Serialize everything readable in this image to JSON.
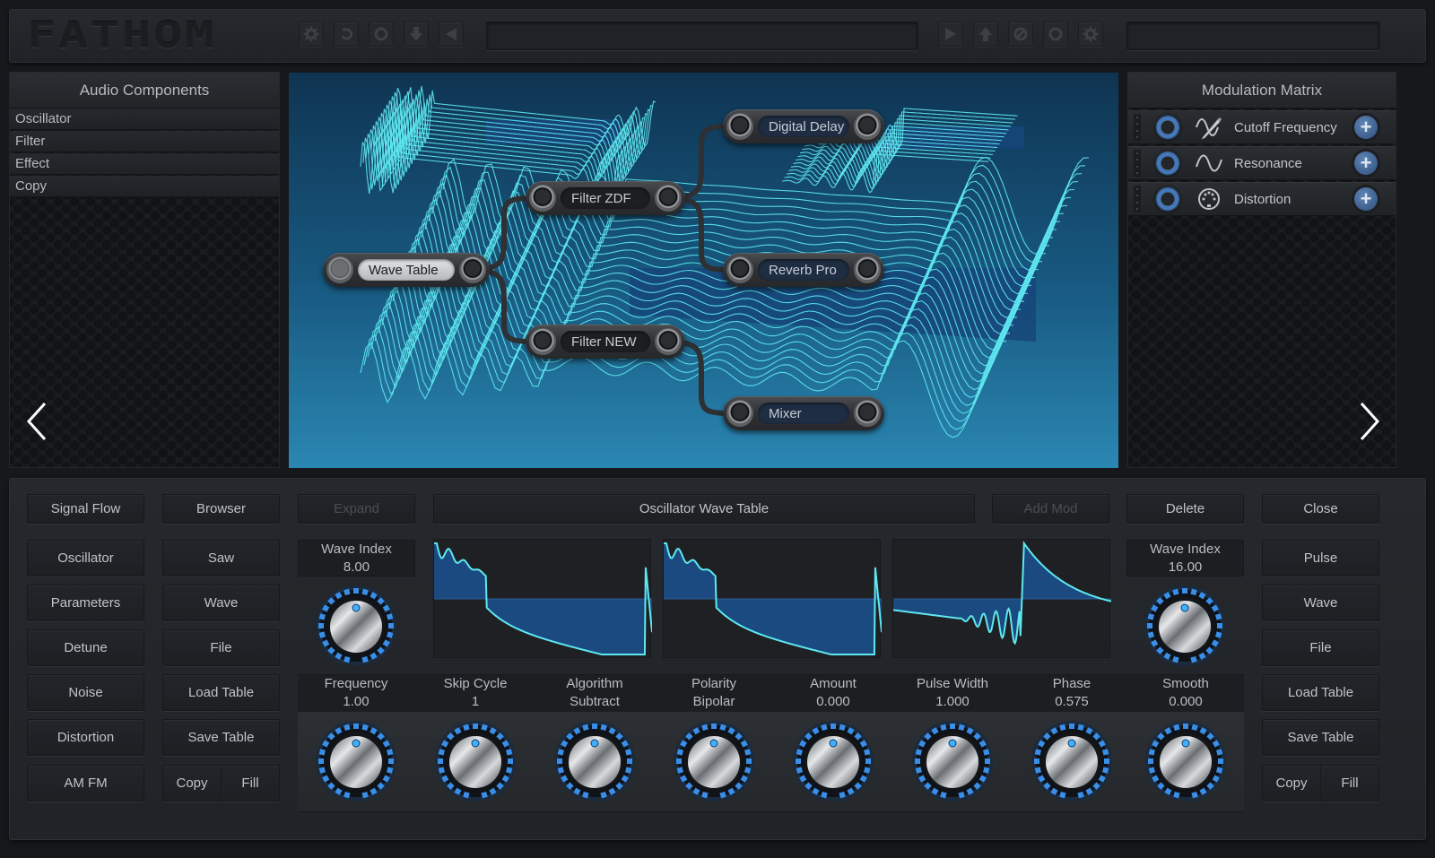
{
  "app": {
    "logo": "FATHOM",
    "accent_color": "#3a8ee8",
    "wave_color": "#5ee8f0",
    "wave_fill_color": "#1a4a80"
  },
  "toolbar": {
    "left_icons": [
      "gear-icon",
      "undo-icon",
      "circle-icon",
      "download-arrow-icon",
      "play-back-icon"
    ],
    "right_icons": [
      "play-icon",
      "upload-arrow-icon",
      "no-entry-icon",
      "circle-icon",
      "gear-icon"
    ],
    "center_field_value": "",
    "right_field_value": ""
  },
  "audio_components": {
    "title": "Audio Components",
    "items": [
      {
        "label": "Oscillator"
      },
      {
        "label": "Filter"
      },
      {
        "label": "Effect"
      },
      {
        "label": "Copy"
      }
    ]
  },
  "modulation_matrix": {
    "title": "Modulation Matrix",
    "rows": [
      {
        "label": "Cutoff Frequency",
        "icon": "pencil-wave-icon"
      },
      {
        "label": "Resonance",
        "icon": "sine-wave-icon"
      },
      {
        "label": "Distortion",
        "icon": "midi-port-icon"
      }
    ]
  },
  "signal_flow": {
    "nodes": [
      {
        "id": "wave-table",
        "label": "Wave Table"
      },
      {
        "id": "filter-zdf",
        "label": "Filter ZDF"
      },
      {
        "id": "filter-new",
        "label": "Filter NEW"
      },
      {
        "id": "digital-delay",
        "label": "Digital Delay"
      },
      {
        "id": "reverb-pro",
        "label": "Reverb Pro"
      },
      {
        "id": "mixer",
        "label": "Mixer"
      }
    ],
    "connections": [
      [
        "wave-table",
        "filter-zdf"
      ],
      [
        "wave-table",
        "filter-new"
      ],
      [
        "filter-zdf",
        "digital-delay"
      ],
      [
        "filter-zdf",
        "reverb-pro"
      ],
      [
        "filter-new",
        "mixer"
      ]
    ]
  },
  "nav": {
    "prev": "‹",
    "next": "›"
  },
  "bottom": {
    "left_col1": [
      "Signal Flow",
      "Oscillator",
      "Parameters",
      "Detune",
      "Noise",
      "Distortion",
      "AM FM"
    ],
    "left_col2": [
      "Browser",
      "Saw",
      "Wave",
      "File",
      "Load Table",
      "Save Table"
    ],
    "left_col2_split": [
      "Copy",
      "Fill"
    ],
    "expand_label": "Expand",
    "title_label": "Oscillator Wave Table",
    "add_mod_label": "Add Mod",
    "delete_label": "Delete",
    "close_label": "Close",
    "right_col": [
      "Pulse",
      "Wave",
      "File",
      "Load Table",
      "Save Table"
    ],
    "right_col_split": [
      "Copy",
      "Fill"
    ],
    "wave_index_left": {
      "label": "Wave Index",
      "value": "8.00"
    },
    "wave_index_right": {
      "label": "Wave Index",
      "value": "16.00"
    },
    "params": [
      {
        "label": "Frequency",
        "value": "1.00"
      },
      {
        "label": "Skip Cycle",
        "value": "1"
      },
      {
        "label": "Algorithm",
        "value": "Subtract"
      },
      {
        "label": "Polarity",
        "value": "Bipolar"
      },
      {
        "label": "Amount",
        "value": "0.000"
      },
      {
        "label": "Pulse Width",
        "value": "1.000"
      },
      {
        "label": "Phase",
        "value": "0.575"
      },
      {
        "label": "Smooth",
        "value": "0.000"
      }
    ]
  }
}
